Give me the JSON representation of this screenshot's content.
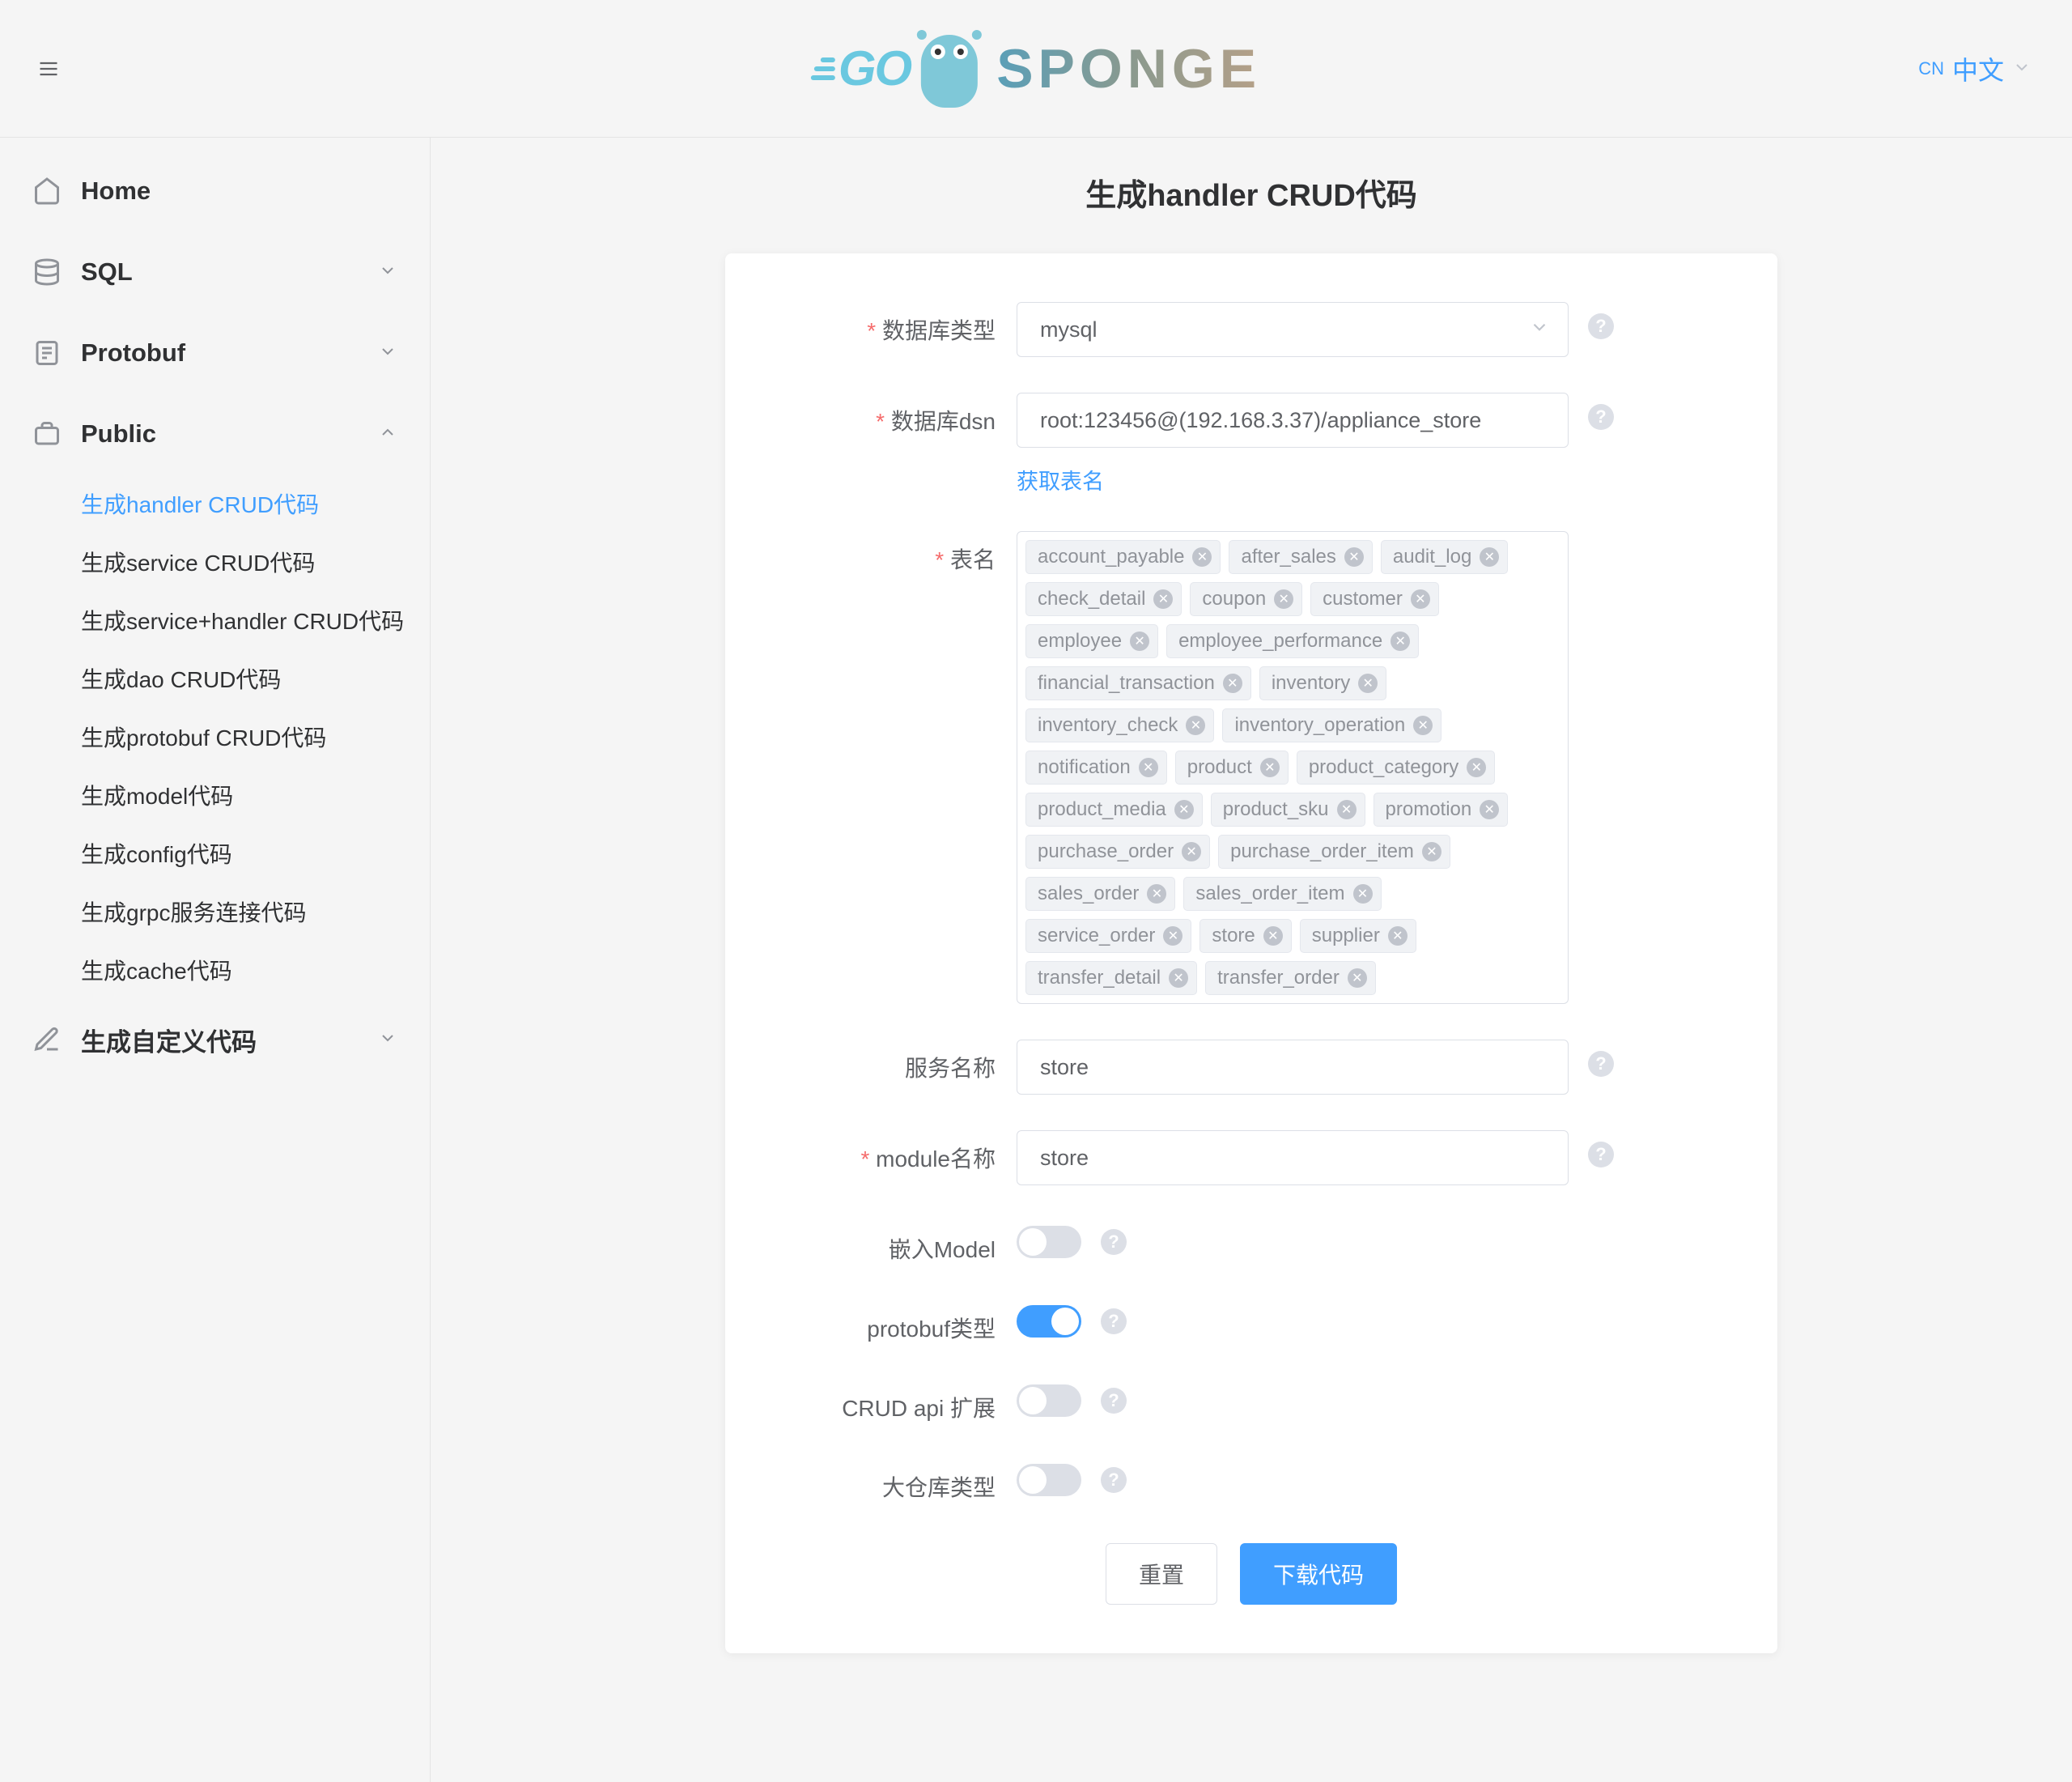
{
  "header": {
    "logo_go": "GO",
    "logo_sponge": "SPONGE",
    "lang_code": "CN",
    "lang_label": "中文"
  },
  "sidebar": {
    "home": "Home",
    "sql": "SQL",
    "protobuf": "Protobuf",
    "public": "Public",
    "public_items": [
      "生成handler CRUD代码",
      "生成service CRUD代码",
      "生成service+handler CRUD代码",
      "生成dao CRUD代码",
      "生成protobuf CRUD代码",
      "生成model代码",
      "生成config代码",
      "生成grpc服务连接代码",
      "生成cache代码"
    ],
    "custom": "生成自定义代码"
  },
  "page": {
    "title": "生成handler CRUD代码"
  },
  "form": {
    "db_type_label": "数据库类型",
    "db_type_value": "mysql",
    "dsn_label": "数据库dsn",
    "dsn_value": "root:123456@(192.168.3.37)/appliance_store",
    "fetch_tables": "获取表名",
    "table_label": "表名",
    "tables": [
      "account_payable",
      "after_sales",
      "audit_log",
      "check_detail",
      "coupon",
      "customer",
      "employee",
      "employee_performance",
      "financial_transaction",
      "inventory",
      "inventory_check",
      "inventory_operation",
      "notification",
      "product",
      "product_category",
      "product_media",
      "product_sku",
      "promotion",
      "purchase_order",
      "purchase_order_item",
      "sales_order",
      "sales_order_item",
      "service_order",
      "store",
      "supplier",
      "transfer_detail",
      "transfer_order"
    ],
    "service_name_label": "服务名称",
    "service_name_value": "store",
    "module_name_label": "module名称",
    "module_name_value": "store",
    "embed_model_label": "嵌入Model",
    "embed_model_value": false,
    "protobuf_type_label": "protobuf类型",
    "protobuf_type_value": true,
    "crud_api_label": "CRUD api 扩展",
    "crud_api_value": false,
    "mono_repo_label": "大仓库类型",
    "mono_repo_value": false,
    "reset_btn": "重置",
    "download_btn": "下载代码"
  }
}
